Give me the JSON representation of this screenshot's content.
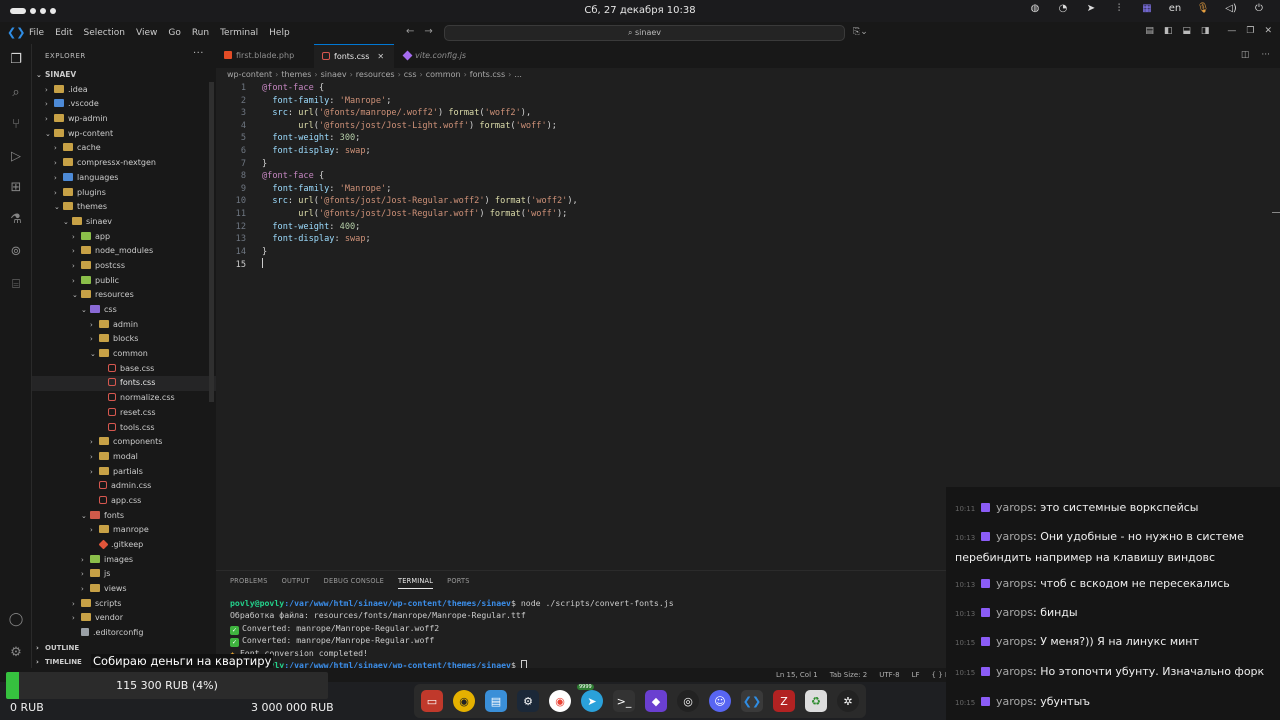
{
  "system": {
    "clock": "Сб, 27 декабря 10:38",
    "lang": "en"
  },
  "titlebar": {
    "menu": [
      "File",
      "Edit",
      "Selection",
      "View",
      "Go",
      "Run",
      "Terminal",
      "Help"
    ],
    "search": "sinaev"
  },
  "sidebar": {
    "header": "EXPLORER",
    "root": "SINAEV",
    "tree": [
      {
        "label": ".idea",
        "depth": 1,
        "chev": "›",
        "icon": "folder"
      },
      {
        "label": ".vscode",
        "depth": 1,
        "chev": "›",
        "icon": "folder blue"
      },
      {
        "label": "wp-admin",
        "depth": 1,
        "chev": "›",
        "icon": "folder"
      },
      {
        "label": "wp-content",
        "depth": 1,
        "chev": "⌄",
        "icon": "folder"
      },
      {
        "label": "cache",
        "depth": 2,
        "chev": "›",
        "icon": "folder"
      },
      {
        "label": "compressx-nextgen",
        "depth": 2,
        "chev": "›",
        "icon": "folder"
      },
      {
        "label": "languages",
        "depth": 2,
        "chev": "›",
        "icon": "folder blue"
      },
      {
        "label": "plugins",
        "depth": 2,
        "chev": "›",
        "icon": "folder"
      },
      {
        "label": "themes",
        "depth": 2,
        "chev": "⌄",
        "icon": "folder"
      },
      {
        "label": "sinaev",
        "depth": 3,
        "chev": "⌄",
        "icon": "folder"
      },
      {
        "label": "app",
        "depth": 4,
        "chev": "›",
        "icon": "folder green"
      },
      {
        "label": "node_modules",
        "depth": 4,
        "chev": "›",
        "icon": "folder"
      },
      {
        "label": "postcss",
        "depth": 4,
        "chev": "›",
        "icon": "folder"
      },
      {
        "label": "public",
        "depth": 4,
        "chev": "›",
        "icon": "folder green"
      },
      {
        "label": "resources",
        "depth": 4,
        "chev": "⌄",
        "icon": "folder"
      },
      {
        "label": "css",
        "depth": 5,
        "chev": "⌄",
        "icon": "folder purple"
      },
      {
        "label": "admin",
        "depth": 6,
        "chev": "›",
        "icon": "folder"
      },
      {
        "label": "blocks",
        "depth": 6,
        "chev": "›",
        "icon": "folder"
      },
      {
        "label": "common",
        "depth": 6,
        "chev": "⌄",
        "icon": "folder"
      },
      {
        "label": "base.css",
        "depth": 7,
        "chev": "",
        "icon": "css"
      },
      {
        "label": "fonts.css",
        "depth": 7,
        "chev": "",
        "icon": "css",
        "selected": true
      },
      {
        "label": "normalize.css",
        "depth": 7,
        "chev": "",
        "icon": "css"
      },
      {
        "label": "reset.css",
        "depth": 7,
        "chev": "",
        "icon": "css"
      },
      {
        "label": "tools.css",
        "depth": 7,
        "chev": "",
        "icon": "css"
      },
      {
        "label": "components",
        "depth": 6,
        "chev": "›",
        "icon": "folder"
      },
      {
        "label": "modal",
        "depth": 6,
        "chev": "›",
        "icon": "folder"
      },
      {
        "label": "partials",
        "depth": 6,
        "chev": "›",
        "icon": "folder"
      },
      {
        "label": "admin.css",
        "depth": 6,
        "chev": "",
        "icon": "css"
      },
      {
        "label": "app.css",
        "depth": 6,
        "chev": "",
        "icon": "css"
      },
      {
        "label": "fonts",
        "depth": 5,
        "chev": "⌄",
        "icon": "folder red"
      },
      {
        "label": "manrope",
        "depth": 6,
        "chev": "›",
        "icon": "folder"
      },
      {
        "label": ".gitkeep",
        "depth": 6,
        "chev": "",
        "icon": "git"
      },
      {
        "label": "images",
        "depth": 5,
        "chev": "›",
        "icon": "folder green"
      },
      {
        "label": "js",
        "depth": 5,
        "chev": "›",
        "icon": "folder"
      },
      {
        "label": "views",
        "depth": 5,
        "chev": "›",
        "icon": "folder"
      },
      {
        "label": "scripts",
        "depth": 4,
        "chev": "›",
        "icon": "folder"
      },
      {
        "label": "vendor",
        "depth": 4,
        "chev": "›",
        "icon": "folder"
      },
      {
        "label": ".editorconfig",
        "depth": 4,
        "chev": "",
        "icon": "cfg"
      }
    ],
    "outline": "OUTLINE",
    "timeline": "TIMELINE"
  },
  "tabs": [
    {
      "label": "first.blade.php",
      "active": false
    },
    {
      "label": "fonts.css",
      "active": true
    },
    {
      "label": "vite.config.js",
      "active": false
    }
  ],
  "breadcrumbs": [
    "wp-content",
    "themes",
    "sinaev",
    "resources",
    "css",
    "common",
    "fonts.css",
    "..."
  ],
  "code": [
    "@font-face {",
    "  font-family: 'Manrope';",
    "  src: url('@fonts/manrope/.woff2') format('woff2'),",
    "       url('@fonts/jost/Jost-Light.woff') format('woff');",
    "  font-weight: 300;",
    "  font-display: swap;",
    "}",
    "@font-face {",
    "  font-family: 'Manrope';",
    "  src: url('@fonts/jost/Jost-Regular.woff2') format('woff2'),",
    "       url('@fonts/jost/Jost-Regular.woff') format('woff');",
    "  font-weight: 400;",
    "  font-display: swap;",
    "}",
    "",
    ""
  ],
  "panel": {
    "tabs": [
      "PROBLEMS",
      "OUTPUT",
      "DEBUG CONSOLE",
      "TERMINAL",
      "PORTS"
    ],
    "active_tab": "TERMINAL",
    "prompt_user": "povly@povly",
    "prompt_path": ":/var/www/html/sinaev/wp-content/themes/sinaev",
    "command": "$ node ./scripts/convert-fonts.js",
    "lines": [
      "Обработка файла: resources/fonts/manrope/Manrope-Regular.ttf",
      "Converted: manrope/Manrope-Regular.woff2",
      "Converted: manrope/Manrope-Regular.woff",
      "Font conversion completed!"
    ]
  },
  "status": {
    "position": "Ln 15, Col 1",
    "tab_size": "Tab Size: 2",
    "encoding": "UTF-8",
    "eol": "LF",
    "lang": "{ } P"
  },
  "chat": [
    {
      "time": "10:11",
      "user": "yarops",
      "text": "это системные воркспейсы"
    },
    {
      "time": "10:13",
      "user": "yarops",
      "text": "Они удобные - но нужно в системе перебиндить например на клавишу виндовс"
    },
    {
      "time": "10:13",
      "user": "yarops",
      "text": "чтоб с вскодом не пересекались"
    },
    {
      "time": "10:13",
      "user": "yarops",
      "text": "бинды"
    },
    {
      "time": "10:15",
      "user": "yarops",
      "text": "У меня?)) Я на линукс минт"
    },
    {
      "time": "10:15",
      "user": "yarops",
      "text": "Но этопочти убунту. Изначально форк"
    },
    {
      "time": "10:15",
      "user": "yarops",
      "text": "убунтыъ"
    }
  ],
  "donation": {
    "title": "Собираю деньги на квартиру",
    "amount_label": "115 300 RUB (4%)",
    "progress": 0.04,
    "min_label": "0 RUB",
    "max_label": "3 000 000 RUB"
  },
  "dock": {
    "badge": "9999"
  }
}
